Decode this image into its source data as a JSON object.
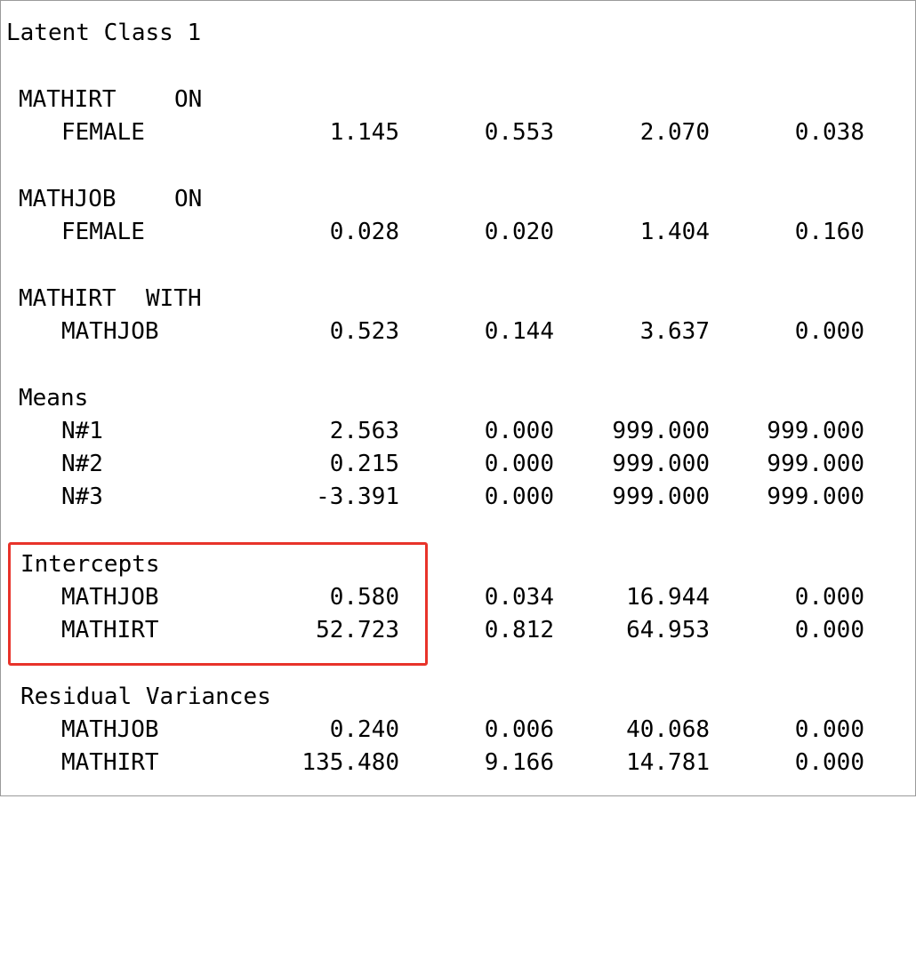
{
  "title": "Latent Class 1",
  "sections": [
    {
      "header": [
        "MATHIRT",
        "ON"
      ],
      "rows": [
        {
          "label": "FEMALE",
          "values": [
            "1.145",
            "0.553",
            "2.070",
            "0.038"
          ]
        }
      ]
    },
    {
      "header": [
        "MATHJOB",
        "ON"
      ],
      "rows": [
        {
          "label": "FEMALE",
          "values": [
            "0.028",
            "0.020",
            "1.404",
            "0.160"
          ]
        }
      ]
    },
    {
      "header": [
        "MATHIRT",
        "WITH"
      ],
      "rows": [
        {
          "label": "MATHJOB",
          "values": [
            "0.523",
            "0.144",
            "3.637",
            "0.000"
          ]
        }
      ]
    },
    {
      "header": [
        "Means"
      ],
      "rows": [
        {
          "label": "N#1",
          "values": [
            "2.563",
            "0.000",
            "999.000",
            "999.000"
          ]
        },
        {
          "label": "N#2",
          "values": [
            "0.215",
            "0.000",
            "999.000",
            "999.000"
          ]
        },
        {
          "label": "N#3",
          "values": [
            "-3.391",
            "0.000",
            "999.000",
            "999.000"
          ]
        }
      ]
    },
    {
      "header": [
        "Intercepts"
      ],
      "rows": [
        {
          "label": "MATHJOB",
          "values": [
            "0.580",
            "0.034",
            "16.944",
            "0.000"
          ]
        },
        {
          "label": "MATHIRT",
          "values": [
            "52.723",
            "0.812",
            "64.953",
            "0.000"
          ]
        }
      ]
    },
    {
      "header": [
        "Residual Variances"
      ],
      "rows": [
        {
          "label": "MATHJOB",
          "values": [
            "0.240",
            "0.006",
            "40.068",
            "0.000"
          ]
        },
        {
          "label": "MATHIRT",
          "values": [
            "135.480",
            "9.166",
            "14.781",
            "0.000"
          ]
        }
      ]
    }
  ],
  "highlight_color": "#e8332a"
}
